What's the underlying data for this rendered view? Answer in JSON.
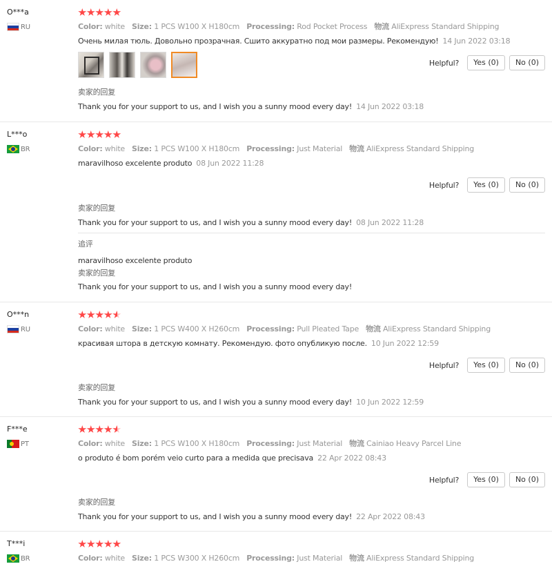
{
  "labels": {
    "color": "Color:",
    "size": "Size:",
    "processing": "Processing:",
    "shipping": "物流",
    "helpful": "Helpful?",
    "seller_reply": "卖家的回复",
    "additional": "追评"
  },
  "reviews": [
    {
      "user": "O***a",
      "country": "RU",
      "stars": 5,
      "color": "white",
      "size": "1 PCS W100 X H180cm",
      "processing": "Rod Pocket Process",
      "shipping": "AliExpress Standard Shipping",
      "text": "Очень милая тюль. Довольно прозрачная. Сшито аккуратно под мои размеры. Рекомендую!",
      "date": "14 Jun 2022 03:18",
      "yes": "Yes (0)",
      "no": "No (0)",
      "reply": "Thank you for your support to us, and I wish you a sunny mood every day!",
      "reply_date": "14 Jun 2022 03:18"
    },
    {
      "user": "L***o",
      "country": "BR",
      "stars": 5,
      "color": "white",
      "size": "1 PCS W100 X H180cm",
      "processing": "Just Material",
      "shipping": "AliExpress Standard Shipping",
      "text": "maravilhoso excelente produto",
      "date": "08 Jun 2022 11:28",
      "yes": "Yes (0)",
      "no": "No (0)",
      "reply": "Thank you for your support to us, and I wish you a sunny mood every day!",
      "reply_date": "08 Jun 2022 11:28",
      "followup": "maravilhoso excelente produto",
      "followup_reply": "Thank you for your support to us, and I wish you a sunny mood every day!"
    },
    {
      "user": "O***n",
      "country": "RU",
      "stars": 4.5,
      "color": "white",
      "size": "1 PCS W400 X H260cm",
      "processing": "Pull Pleated Tape",
      "shipping": "AliExpress Standard Shipping",
      "text": "красивая штора в детскую комнату. Рекомендую. фото опубликую после.",
      "date": "10 Jun 2022 12:59",
      "yes": "Yes (0)",
      "no": "No (0)",
      "reply": "Thank you for your support to us, and I wish you a sunny mood every day!",
      "reply_date": "10 Jun 2022 12:59"
    },
    {
      "user": "F***e",
      "country": "PT",
      "stars": 4.5,
      "color": "white",
      "size": "1 PCS W100 X H180cm",
      "processing": "Just Material",
      "shipping": "Cainiao Heavy Parcel Line",
      "text": "o produto é bom porém veio curto para a medida que precisava",
      "date": "22 Apr 2022 08:43",
      "yes": "Yes (0)",
      "no": "No (0)",
      "reply": "Thank you for your support to us, and I wish you a sunny mood every day!",
      "reply_date": "22 Apr 2022 08:43"
    },
    {
      "user": "T***i",
      "country": "BR",
      "stars": 5,
      "color": "white",
      "size": "1 PCS W300 X H260cm",
      "processing": "Just Material",
      "shipping": "AliExpress Standard Shipping"
    }
  ]
}
